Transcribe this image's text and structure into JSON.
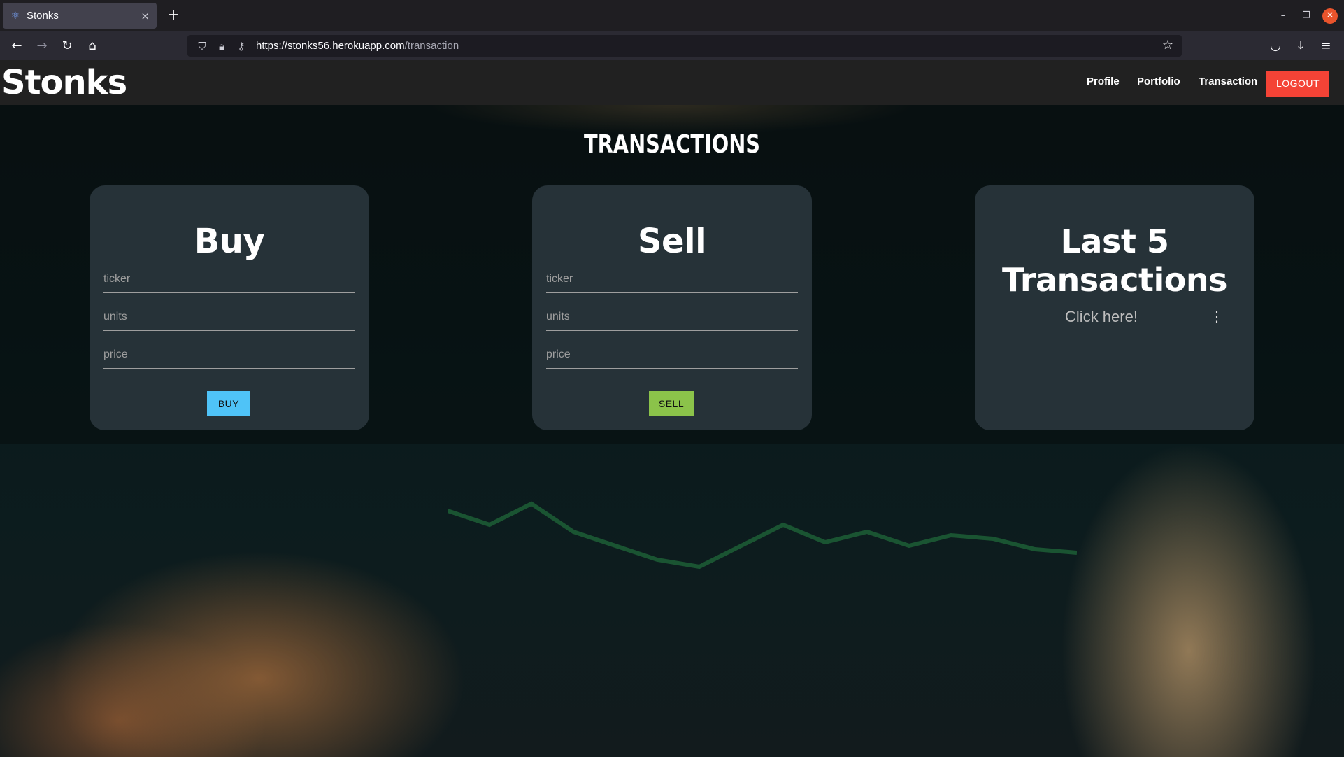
{
  "browser": {
    "tab_title": "Stonks",
    "tab_close": "×",
    "new_tab": "+",
    "url_host": "https://stonks56.herokuapp.com",
    "url_path": "/transaction"
  },
  "app": {
    "brand": "Stonks",
    "nav": {
      "profile": "Profile",
      "portfolio": "Portfolio",
      "transaction": "Transaction",
      "logout": "LOGOUT"
    },
    "page_title": "TRANSACTIONS",
    "buy_card": {
      "title": "Buy",
      "ticker_placeholder": "ticker",
      "units_placeholder": "units",
      "price_placeholder": "price",
      "button": "BUY"
    },
    "sell_card": {
      "title": "Sell",
      "ticker_placeholder": "ticker",
      "units_placeholder": "units",
      "price_placeholder": "price",
      "button": "SELL"
    },
    "last_card": {
      "title_line1": "Last 5",
      "title_line2": "Transactions",
      "link": "Click here!",
      "menu_icon": "⋮"
    }
  },
  "colors": {
    "buy": "#4fc3f7",
    "sell": "#8bc34a",
    "logout": "#f44336",
    "card": "#263238"
  }
}
